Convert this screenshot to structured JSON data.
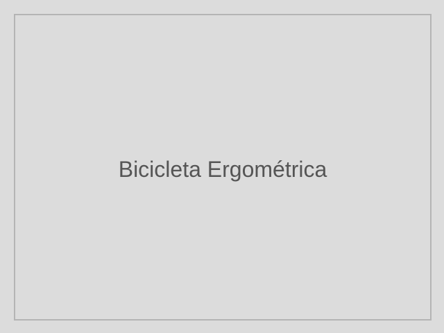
{
  "placeholder": {
    "text": "Bicicleta Ergométrica"
  },
  "colors": {
    "background": "#dcdcdc",
    "border": "#b4b4b4",
    "text": "#555555"
  }
}
